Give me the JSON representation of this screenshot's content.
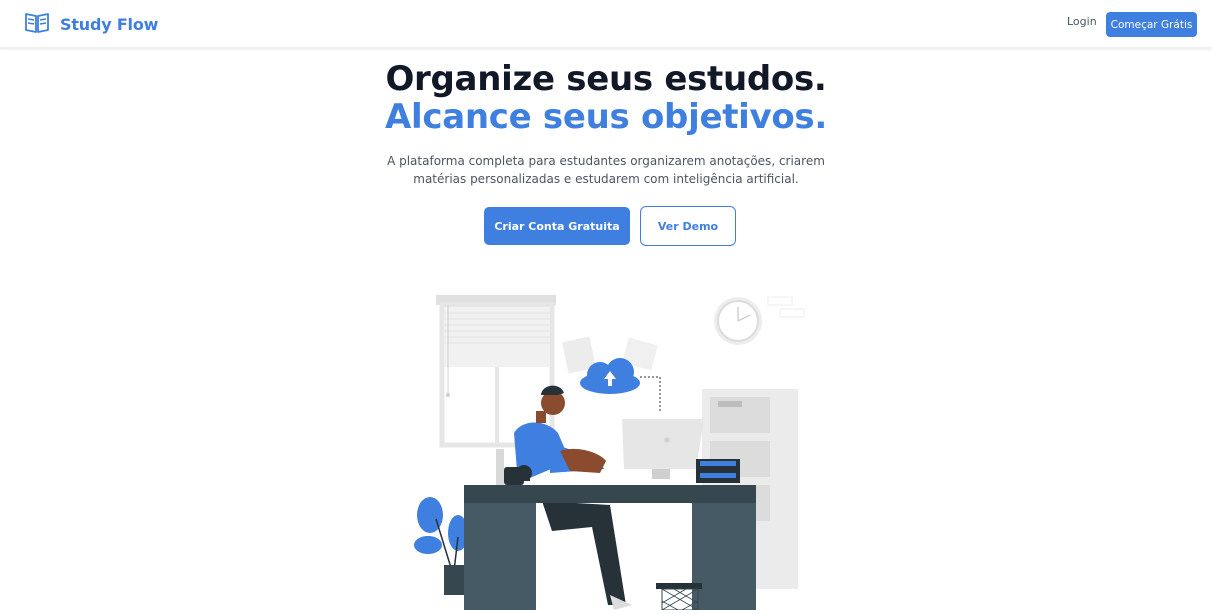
{
  "header": {
    "brand_name": "Study Flow",
    "brand_icon": "open-book-icon",
    "login_label": "Login",
    "start_label": "Começar Grátis"
  },
  "hero": {
    "title_line1": "Organize seus estudos.",
    "title_line2": "Alcance seus objetivos.",
    "subtitle_line1": "A plataforma completa para estudantes organizarem anotações, criarem",
    "subtitle_line2": "matérias personalizadas e estudarem com inteligência artificial.",
    "primary_cta": "Criar Conta Gratuita",
    "secondary_cta": "Ver Demo"
  },
  "illustration": {
    "icons": [
      "person-at-desk-icon",
      "cloud-upload-icon",
      "wall-clock-icon",
      "window-blinds-icon",
      "plant-icon",
      "computer-monitor-icon",
      "filing-cabinet-icon",
      "trash-bin-icon",
      "coffee-mug-icon"
    ]
  },
  "colors": {
    "accent": "#3e7fe0",
    "title_dark": "#111827",
    "text_muted": "#4b5563"
  }
}
